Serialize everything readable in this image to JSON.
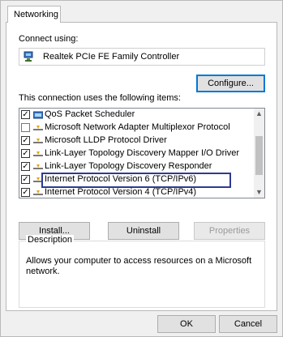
{
  "tab": {
    "label": "Networking"
  },
  "connect": {
    "label": "Connect using:",
    "adapter": "Realtek PCIe FE Family Controller",
    "adapter_icon": "network-adapter-icon",
    "configure_button": "Configure..."
  },
  "items": {
    "label": "This connection uses the following items:",
    "list": [
      {
        "checked": true,
        "icon": "qos-icon",
        "label": "QoS Packet Scheduler"
      },
      {
        "checked": false,
        "icon": "protocol-icon",
        "label": "Microsoft Network Adapter Multiplexor Protocol"
      },
      {
        "checked": true,
        "icon": "protocol-icon",
        "label": "Microsoft LLDP Protocol Driver"
      },
      {
        "checked": true,
        "icon": "protocol-icon",
        "label": "Link-Layer Topology Discovery Mapper I/O Driver"
      },
      {
        "checked": true,
        "icon": "protocol-icon",
        "label": "Link-Layer Topology Discovery Responder"
      },
      {
        "checked": true,
        "icon": "protocol-icon",
        "label": "Internet Protocol Version 6 (TCP/IPv6)"
      },
      {
        "checked": true,
        "icon": "protocol-icon",
        "label": "Internet Protocol Version 4 (TCP/IPv4)"
      }
    ]
  },
  "actions": {
    "install": "Install...",
    "uninstall": "Uninstall",
    "properties": "Properties"
  },
  "description": {
    "title": "Description",
    "text": "Allows your computer to access resources on a Microsoft network."
  },
  "dialog": {
    "ok": "OK",
    "cancel": "Cancel"
  },
  "colors": {
    "highlight_border": "#2f3a91",
    "focus_border": "#0078d7"
  }
}
